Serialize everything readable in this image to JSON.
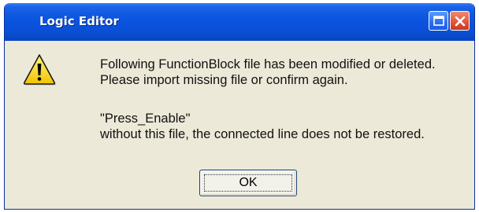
{
  "window": {
    "title": "Logic Editor",
    "controls": [
      "maximize-icon",
      "close-icon"
    ],
    "titlebar_color": "#0b55e0"
  },
  "message": {
    "icon": "warning-icon",
    "line1": "Following FunctionBlock file has been modified or deleted.",
    "line2": "Please import missing file or confirm again.",
    "line3": "\"Press_Enable\"",
    "line4": "without this file, the connected line does not be restored."
  },
  "buttons": {
    "ok_label": "OK"
  }
}
